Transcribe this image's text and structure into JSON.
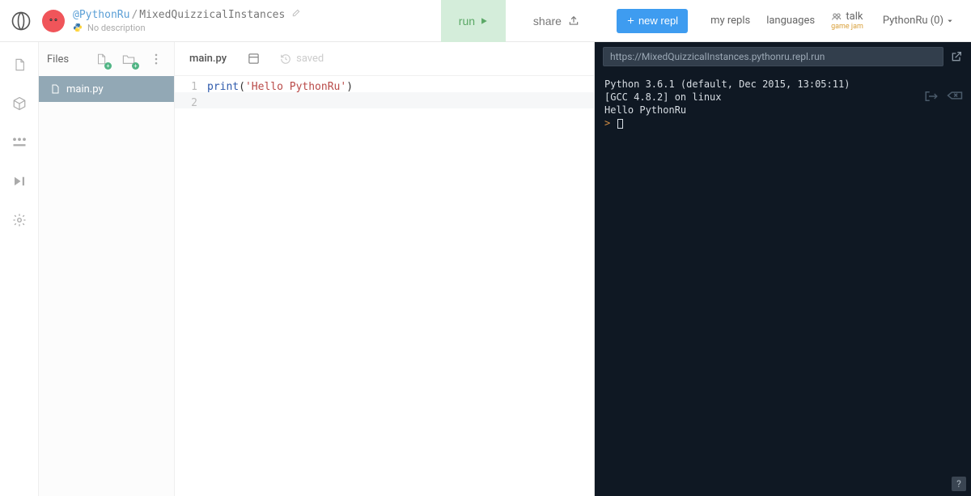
{
  "header": {
    "author": "@PythonRu",
    "separator": "/",
    "project": "MixedQuizzicalInstances",
    "description": "No description",
    "run_label": "run",
    "share_label": "share",
    "new_repl_label": "new repl",
    "nav": {
      "my_repls": "my repls",
      "languages": "languages",
      "talk": "talk",
      "talk_sub": "game jam"
    },
    "user_menu": "PythonRu (0)"
  },
  "files": {
    "title": "Files",
    "items": [
      {
        "name": "main.py"
      }
    ]
  },
  "editor": {
    "tab": "main.py",
    "saved": "saved",
    "lines": [
      "1",
      "2"
    ],
    "code": {
      "fn": "print",
      "open": "(",
      "str": "'Hello PythonRu'",
      "close": ")"
    }
  },
  "console": {
    "url": "https://MixedQuizzicalInstances.pythonru.repl.run",
    "line1": "Python 3.6.1 (default, Dec 2015, 13:05:11)",
    "line2": "[GCC 4.8.2] on linux",
    "line3": "Hello PythonRu",
    "prompt": ">",
    "help": "?"
  }
}
